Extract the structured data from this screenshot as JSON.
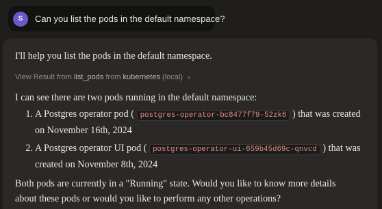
{
  "user_message": {
    "avatar_initial": "S",
    "text": "Can you list the pods in the default namespace?"
  },
  "assistant": {
    "intro": "I'll help you list the pods in the default namespace.",
    "tool_result": {
      "prefix": "View Result from",
      "tool_name": "list_pods",
      "from_word": "from",
      "server": "kubernetes",
      "server_suffix": "(local)",
      "chevron_icon": "chevron-right-icon"
    },
    "summary": "I can see there are two pods running in the default namespace:",
    "pods": [
      {
        "number": "1.",
        "before": "A Postgres operator pod (",
        "name": "postgres-operator-bc8477f79-52zk6",
        "after": ") that was created on November 16th, 2024"
      },
      {
        "number": "2.",
        "before": "A Postgres operator UI pod (",
        "name": "postgres-operator-ui-659b45d69c-qnvcd",
        "after": ") that was created on November 8th, 2024"
      }
    ],
    "closing": "Both pods are currently in a \"Running\" state. Would you like to know more details about these pods or would you like to perform any other operations?"
  },
  "colors": {
    "background": "#1f1e1d",
    "user_bubble": "#121211",
    "avatar": "#6d57c4",
    "response_panel": "#2a2927",
    "code_text": "#e48d84"
  }
}
